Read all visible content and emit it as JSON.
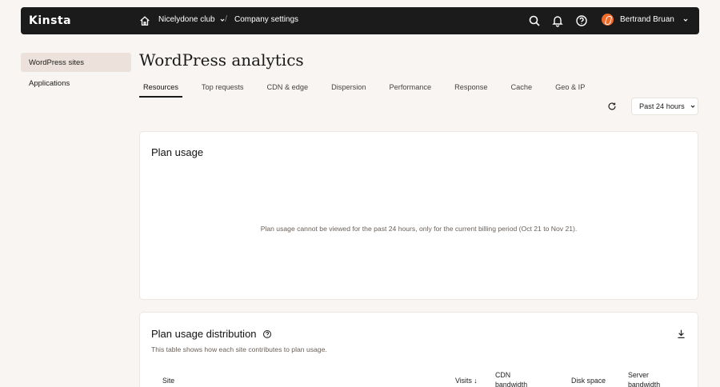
{
  "header": {
    "logo": "Kinsta",
    "company": "Nicelydone club",
    "separator": "/",
    "page": "Company settings",
    "user_name": "Bertrand Bruan"
  },
  "sidebar": {
    "items": [
      {
        "label": "WordPress sites",
        "active": true
      },
      {
        "label": "Applications",
        "active": false
      }
    ]
  },
  "main": {
    "title": "WordPress analytics",
    "tabs": [
      {
        "label": "Resources",
        "active": true
      },
      {
        "label": "Top requests"
      },
      {
        "label": "CDN & edge"
      },
      {
        "label": "Dispersion"
      },
      {
        "label": "Performance"
      },
      {
        "label": "Response"
      },
      {
        "label": "Cache"
      },
      {
        "label": "Geo & IP"
      }
    ],
    "range_label": "Past 24 hours"
  },
  "plan_usage": {
    "title": "Plan usage",
    "message": "Plan usage cannot be viewed for the past 24 hours, only for the current billing period (Oct 21 to Nov 21)."
  },
  "distribution": {
    "title": "Plan usage distribution",
    "subtitle": "This table shows how each site contributes to plan usage.",
    "columns": [
      "Site",
      "Visits ↓",
      "CDN\nbandwidth",
      "Disk space",
      "Server\nbandwidth"
    ]
  }
}
